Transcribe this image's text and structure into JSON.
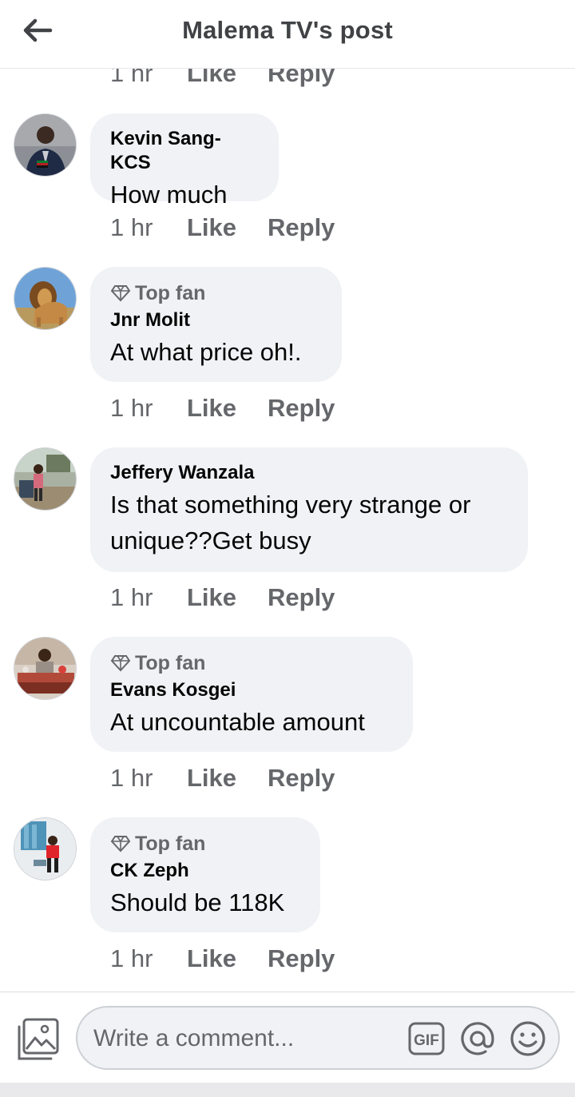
{
  "header": {
    "title": "Malema TV's post"
  },
  "partial_row": {
    "time": "1 hr",
    "like": "Like",
    "reply": "Reply"
  },
  "comments": [
    {
      "top_fan": "",
      "author": "Kevin Sang-KCS",
      "text": "How much",
      "time": "1 hr",
      "like": "Like",
      "reply": "Reply"
    },
    {
      "top_fan": "Top fan",
      "author": "Jnr Molit",
      "text": "At what price oh!.",
      "time": "1 hr",
      "like": "Like",
      "reply": "Reply"
    },
    {
      "top_fan": "",
      "author": "Jeffery Wanzala",
      "text": "Is that something very strange or unique??Get busy",
      "time": "1 hr",
      "like": "Like",
      "reply": "Reply"
    },
    {
      "top_fan": "Top fan",
      "author": "Evans Kosgei",
      "text": "At uncountable amount",
      "time": "1 hr",
      "like": "Like",
      "reply": "Reply"
    },
    {
      "top_fan": "Top fan",
      "author": "CK Zeph",
      "text": "Should be 118K",
      "time": "1 hr",
      "like": "Like",
      "reply": "Reply"
    }
  ],
  "composer": {
    "placeholder": "Write a comment...",
    "gif_label": "GIF"
  },
  "icons": {
    "back": "arrow-left-icon",
    "top_fan": "diamond-icon",
    "photo": "image-icon",
    "gif": "gif-icon",
    "mention": "at-icon",
    "emoji": "smiley-icon"
  },
  "colors": {
    "secondary_text": "#65676b",
    "bubble": "#f0f2f5",
    "title": "#404245"
  }
}
